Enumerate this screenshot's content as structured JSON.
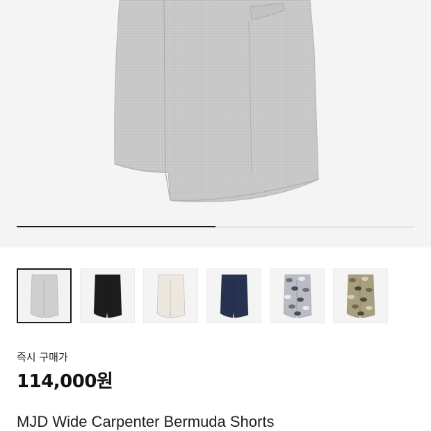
{
  "gallery": {
    "progress_fraction": 0.5,
    "thumbnails": [
      {
        "color_name": "melange-gray",
        "fill": "#cfcfcf",
        "selected": true
      },
      {
        "color_name": "black",
        "fill": "#1c1c1c",
        "selected": false
      },
      {
        "color_name": "ivory",
        "fill": "#ece8de",
        "selected": false
      },
      {
        "color_name": "navy",
        "fill": "#26324f",
        "selected": false
      },
      {
        "color_name": "snow-camo",
        "fill": "#b9bcc4",
        "selected": false
      },
      {
        "color_name": "desert-camo",
        "fill": "#a89f80",
        "selected": false
      }
    ]
  },
  "price": {
    "label": "즉시 구매가",
    "value": "114,000원"
  },
  "product": {
    "name": "MJD Wide Carpenter Bermuda Shorts"
  },
  "colors": {
    "hero_background": "#f4f4f4",
    "shorts_gray": "#c8c8c8",
    "progress_active": "#1a1a1a",
    "progress_track": "#c9c9c9"
  }
}
